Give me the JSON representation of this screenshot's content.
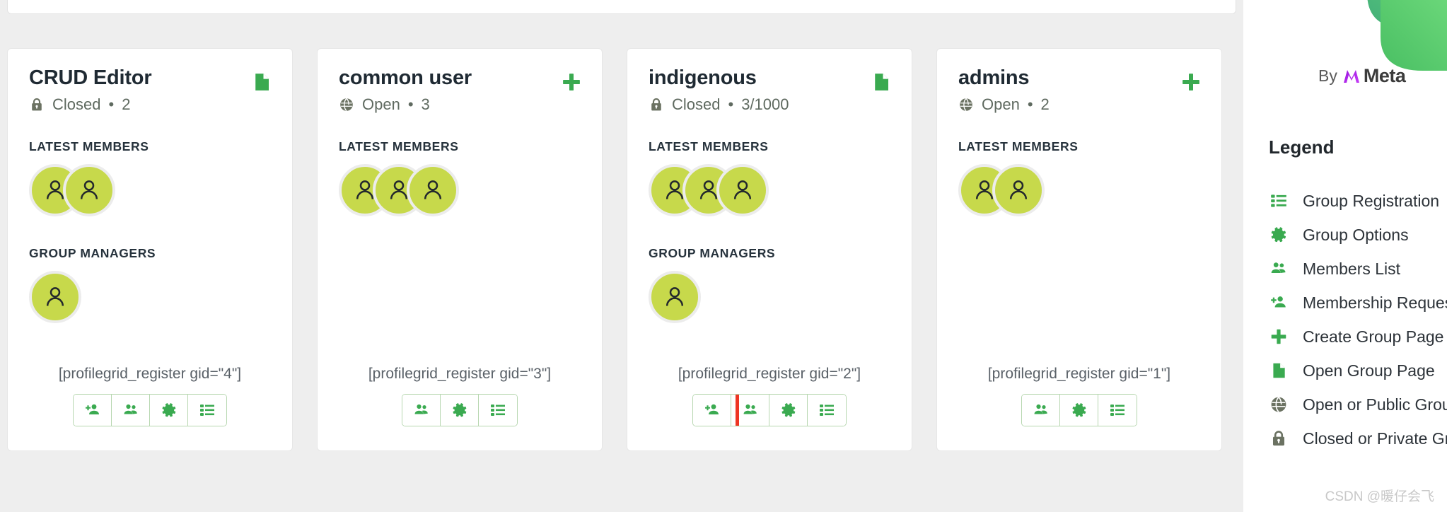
{
  "groups": [
    {
      "title": "CRUD Editor",
      "privacy_icon": "lock-icon",
      "privacy_label": "Closed",
      "separator": "•",
      "count": "2",
      "corner_icon": "open-group-page-icon",
      "latest_members_label": "LATEST MEMBERS",
      "latest_members_count": 2,
      "group_managers_label": "GROUP MANAGERS",
      "group_managers_count": 1,
      "shortcode": "[profilegrid_register gid=\"4\"]",
      "buttons": [
        "membership-request-icon",
        "members-list-icon",
        "group-options-icon",
        "group-registration-icon"
      ],
      "highlighted_button_index": null
    },
    {
      "title": "common user",
      "privacy_icon": "globe-icon",
      "privacy_label": "Open",
      "separator": "•",
      "count": "3",
      "corner_icon": "create-group-page-icon",
      "latest_members_label": "LATEST MEMBERS",
      "latest_members_count": 3,
      "group_managers_label": "",
      "group_managers_count": 0,
      "shortcode": "[profilegrid_register gid=\"3\"]",
      "buttons": [
        "members-list-icon",
        "group-options-icon",
        "group-registration-icon"
      ],
      "highlighted_button_index": null
    },
    {
      "title": "indigenous",
      "privacy_icon": "lock-icon",
      "privacy_label": "Closed",
      "separator": "•",
      "count": "3/1000",
      "corner_icon": "open-group-page-icon",
      "latest_members_label": "LATEST MEMBERS",
      "latest_members_count": 3,
      "group_managers_label": "GROUP MANAGERS",
      "group_managers_count": 1,
      "shortcode": "[profilegrid_register gid=\"2\"]",
      "buttons": [
        "membership-request-icon",
        "members-list-icon",
        "group-options-icon",
        "group-registration-icon"
      ],
      "highlighted_button_index": 0
    },
    {
      "title": "admins",
      "privacy_icon": "globe-icon",
      "privacy_label": "Open",
      "separator": "•",
      "count": "2",
      "corner_icon": "create-group-page-icon",
      "latest_members_label": "LATEST MEMBERS",
      "latest_members_count": 2,
      "group_managers_label": "",
      "group_managers_count": 0,
      "shortcode": "[profilegrid_register gid=\"1\"]",
      "buttons": [
        "members-list-icon",
        "group-options-icon",
        "group-registration-icon"
      ],
      "highlighted_button_index": null
    }
  ],
  "sidebar": {
    "by_label": "By",
    "brand_name": "Meta",
    "legend_title": "Legend",
    "legend_items": [
      {
        "icon": "group-registration-icon",
        "label": "Group Registration"
      },
      {
        "icon": "group-options-icon",
        "label": "Group Options"
      },
      {
        "icon": "members-list-icon",
        "label": "Members List"
      },
      {
        "icon": "membership-request-icon",
        "label": "Membership Request"
      },
      {
        "icon": "create-group-page-icon",
        "label": "Create Group Page"
      },
      {
        "icon": "open-group-page-icon",
        "label": "Open Group Page"
      },
      {
        "icon": "globe-icon",
        "label": "Open or Public Group"
      },
      {
        "icon": "lock-icon",
        "label": "Closed or Private Group"
      }
    ]
  },
  "watermark": "CSDN @暖仔会飞",
  "colors": {
    "green": "#3aaa50",
    "avatar": "#c7d94b",
    "highlight": "#ee3524",
    "grey_icon": "#6b7262",
    "page_bg": "#eeeeee"
  }
}
